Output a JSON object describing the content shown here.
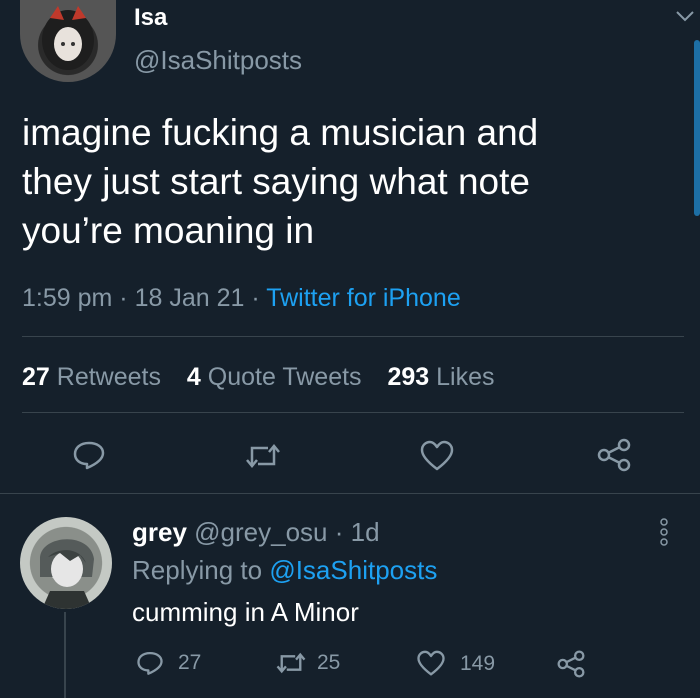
{
  "tweet": {
    "display_name": "Isa",
    "handle": "@IsaShitposts",
    "text_lines": [
      "imagine fucking a musician and",
      "they just start saying what note",
      "you’re moaning in"
    ],
    "time": "1:59 pm",
    "date": "18 Jan 21",
    "sep": "·",
    "source": "Twitter for iPhone",
    "stats": {
      "retweets_count": "27",
      "retweets_label": "Retweets",
      "quotes_count": "4",
      "quotes_label": "Quote Tweets",
      "likes_count": "293",
      "likes_label": "Likes"
    }
  },
  "reply": {
    "display_name": "grey",
    "handle": "@grey_osu",
    "sep": "·",
    "age": "1d",
    "replying_prefix": "Replying to",
    "replying_to": "@IsaShitposts",
    "text": "cumming in A Minor",
    "actions": {
      "reply_count": "27",
      "retweet_count": "25",
      "like_count": "149"
    }
  },
  "colors": {
    "background": "#15202b",
    "accent": "#1da1f2",
    "muted": "#8899a6",
    "divider": "#38444d"
  },
  "icons": [
    "chevron-down-icon",
    "reply-icon",
    "retweet-icon",
    "like-icon",
    "share-icon",
    "more-icon"
  ]
}
